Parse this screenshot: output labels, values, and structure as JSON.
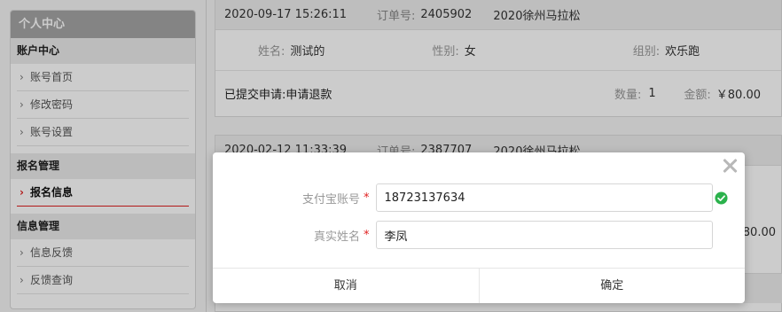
{
  "sidebar": {
    "title": "个人中心",
    "groups": [
      {
        "label": "账户中心",
        "items": [
          {
            "label": "账号首页"
          },
          {
            "label": "修改密码"
          },
          {
            "label": "账号设置"
          }
        ]
      },
      {
        "label": "报名管理",
        "items": [
          {
            "label": "报名信息",
            "active": true
          }
        ]
      },
      {
        "label": "信息管理",
        "items": [
          {
            "label": "信息反馈"
          },
          {
            "label": "反馈查询"
          }
        ]
      }
    ]
  },
  "orders": [
    {
      "time": "2020-09-17 15:26:11",
      "order_no_label": "订单号:",
      "order_no": "2405902",
      "event": "2020徐州马拉松",
      "name_label": "姓名:",
      "name": "测试的",
      "gender_label": "性别:",
      "gender": "女",
      "group_label": "组别:",
      "group": "欢乐跑",
      "status": "已提交申请:申请退款",
      "qty_label": "数量:",
      "qty": "1",
      "amount_label": "金额:",
      "amount": "￥80.00"
    },
    {
      "time": "2020-02-12 11:33:39",
      "order_no_label": "订单号:",
      "order_no": "2387707",
      "event": "2020徐州马拉松",
      "amount_partial": "80.00"
    }
  ],
  "modal": {
    "fields": [
      {
        "label": "支付宝账号",
        "value": "18723137634",
        "valid": true
      },
      {
        "label": "真实姓名",
        "value": "李凤"
      }
    ],
    "required_mark": "*",
    "cancel_label": "取消",
    "confirm_label": "确定"
  },
  "colors": {
    "accent": "#e02020",
    "success": "#2bb24c",
    "sidebar_header": "#a6a6a6"
  },
  "icons": {
    "close": "close-icon",
    "check": "check-circle-icon",
    "chevron": "chevron-right-icon"
  }
}
